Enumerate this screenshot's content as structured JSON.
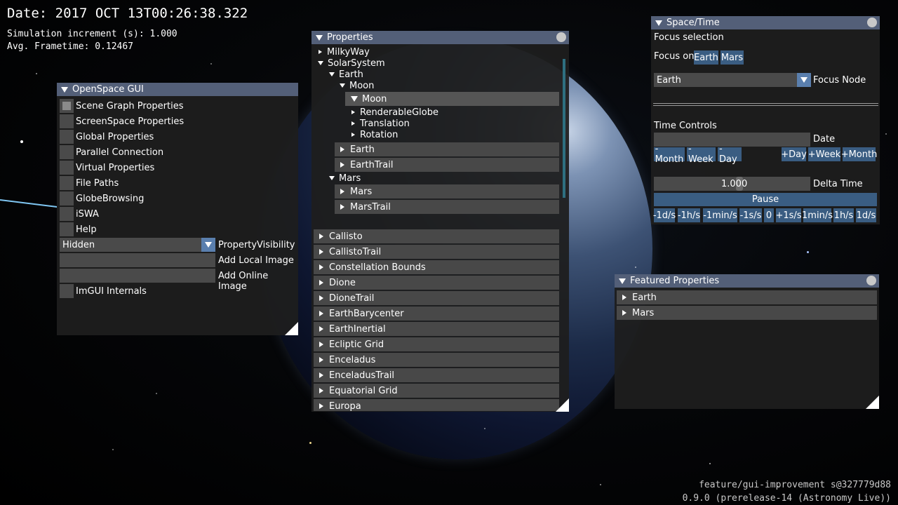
{
  "hud": {
    "date": "Date: 2017 OCT 13T00:26:38.322",
    "simulation_increment": "Simulation increment (s): 1.000",
    "frametime": "Avg. Frametime: 0.12467",
    "branch": "feature/gui-improvement s@327779d88",
    "version": "0.9.0 (prerelease-14 (Astronomy Live))"
  },
  "openspace_gui": {
    "title": "OpenSpace GUI",
    "items": [
      "Scene Graph Properties",
      "ScreenSpace Properties",
      "Global Properties",
      "Parallel Connection",
      "Virtual Properties",
      "File Paths",
      "GlobeBrowsing",
      "iSWA",
      "Help"
    ],
    "property_visibility": {
      "value": "Hidden",
      "label": "PropertyVisibility"
    },
    "add_local_image": "Add Local Image",
    "add_online_image": "Add Online Image",
    "imgui_internals": "ImGUI Internals"
  },
  "properties": {
    "title": "Properties",
    "milkyway": "MilkyWay",
    "solar_system": "SolarSystem",
    "earth_node": "Earth",
    "moon_node": "Moon",
    "moon_header": "Moon",
    "moon_children": [
      "RenderableGlobe",
      "Translation",
      "Rotation"
    ],
    "earth_headers": [
      "Earth",
      "EarthTrail"
    ],
    "mars_node": "Mars",
    "mars_headers": [
      "Mars",
      "MarsTrail"
    ],
    "nodes": [
      "Callisto",
      "CallistoTrail",
      "Constellation Bounds",
      "Dione",
      "DioneTrail",
      "EarthBarycenter",
      "EarthInertial",
      "Ecliptic Grid",
      "Enceladus",
      "EnceladusTrail",
      "Equatorial Grid",
      "Europa"
    ]
  },
  "space_time": {
    "title": "Space/Time",
    "focus_selection": "Focus selection",
    "focus_on": "Focus on:",
    "focus_buttons": [
      "Earth",
      "Mars"
    ],
    "focus_node_value": "Earth",
    "focus_node_label": "Focus Node",
    "time_controls": "Time Controls",
    "date_label": "Date",
    "date_value": "",
    "back_buttons": [
      "-Month",
      "-Week",
      "-Day"
    ],
    "fwd_buttons": [
      "+Day",
      "+Week",
      "+Month"
    ],
    "delta_time_value": "1.000",
    "delta_time_label": "Delta Time",
    "pause": "Pause",
    "rate_buttons": [
      "-1d/s",
      "-1h/s",
      "-1min/s",
      "-1s/s",
      "0",
      "+1s/s",
      "1min/s",
      "1h/s",
      "1d/s"
    ]
  },
  "featured_properties": {
    "title": "Featured Properties",
    "items": [
      "Earth",
      "Mars"
    ]
  }
}
